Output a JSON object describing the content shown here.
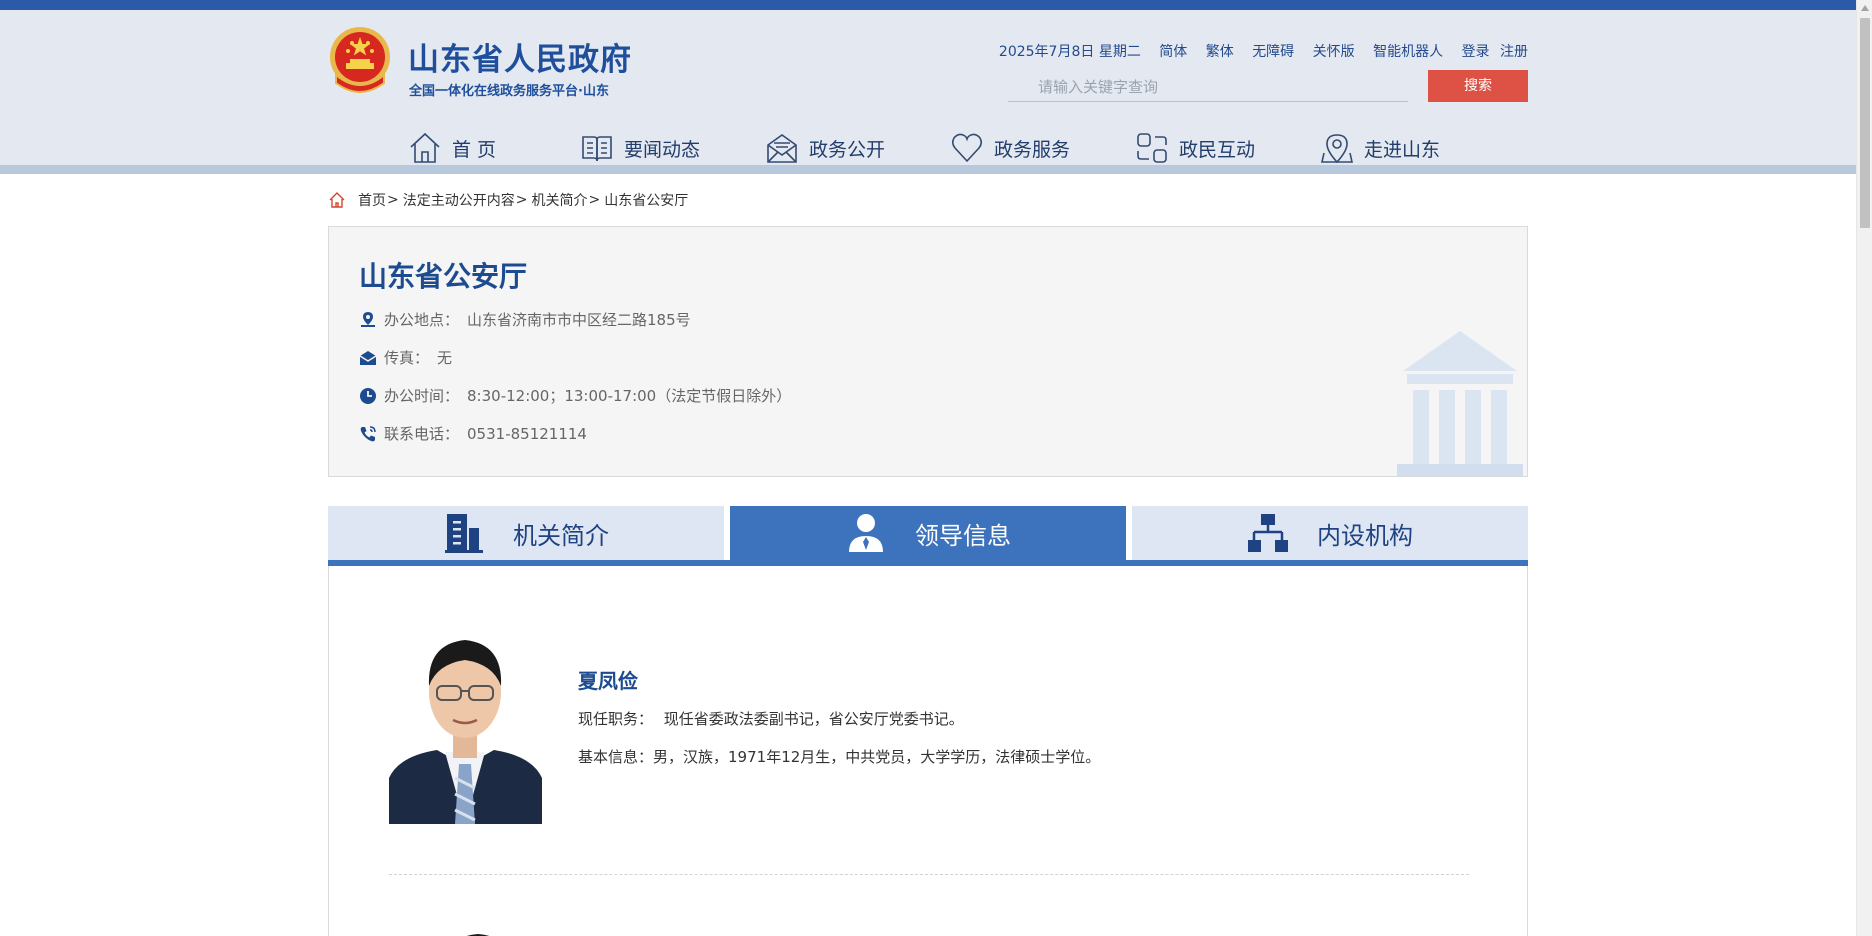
{
  "header": {
    "title": "山东省人民政府",
    "subtitle": "全国一体化在线政务服务平台·山东",
    "date_text": "2025年7月8日 星期二",
    "links": {
      "simplified": "简体",
      "traditional": "繁体",
      "accessible": "无障碍",
      "elder": "关怀版",
      "robot": "智能机器人",
      "login": "登录",
      "register": "注册"
    },
    "search": {
      "placeholder": "请输入关键字查询",
      "button": "搜索"
    }
  },
  "nav": {
    "items": [
      {
        "label": "首 页",
        "icon": "home-icon"
      },
      {
        "label": "要闻动态",
        "icon": "book-icon"
      },
      {
        "label": "政务公开",
        "icon": "mail-open-icon"
      },
      {
        "label": "政务服务",
        "icon": "heart-icon"
      },
      {
        "label": "政民互动",
        "icon": "exchange-icon"
      },
      {
        "label": "走进山东",
        "icon": "map-pin-icon"
      }
    ]
  },
  "breadcrumb": {
    "items": [
      "首页",
      "法定主动公开内容",
      "机关简介",
      "山东省公安厅"
    ],
    "separator": ">"
  },
  "org": {
    "name": "山东省公安厅",
    "address": {
      "label": "办公地点：",
      "value": "山东省济南市市中区经二路185号"
    },
    "fax": {
      "label": "传真：",
      "value": "无"
    },
    "hours": {
      "label": "办公时间：",
      "value": "8:30-12:00；13:00-17:00（法定节假日除外）"
    },
    "phone": {
      "label": "联系电话：",
      "value": "0531-85121114"
    }
  },
  "tabs": [
    {
      "label": "机关简介",
      "icon": "building-icon",
      "active": false
    },
    {
      "label": "领导信息",
      "icon": "person-icon",
      "active": true
    },
    {
      "label": "内设机构",
      "icon": "org-chart-icon",
      "active": false
    }
  ],
  "leaders": [
    {
      "name": "夏凤俭",
      "position_label": "现任职务：",
      "position": "现任省委政法委副书记，省公安厅党委书记。",
      "basic_label": "基本信息：",
      "basic": "男，汉族，1971年12月生，中共党员，大学学历，法律硕士学位。"
    }
  ],
  "colors": {
    "top_strip": "#2a5aa8",
    "brand_blue": "#1f4f9c",
    "tab_active": "#3d72bc",
    "search_button": "#de5145"
  }
}
